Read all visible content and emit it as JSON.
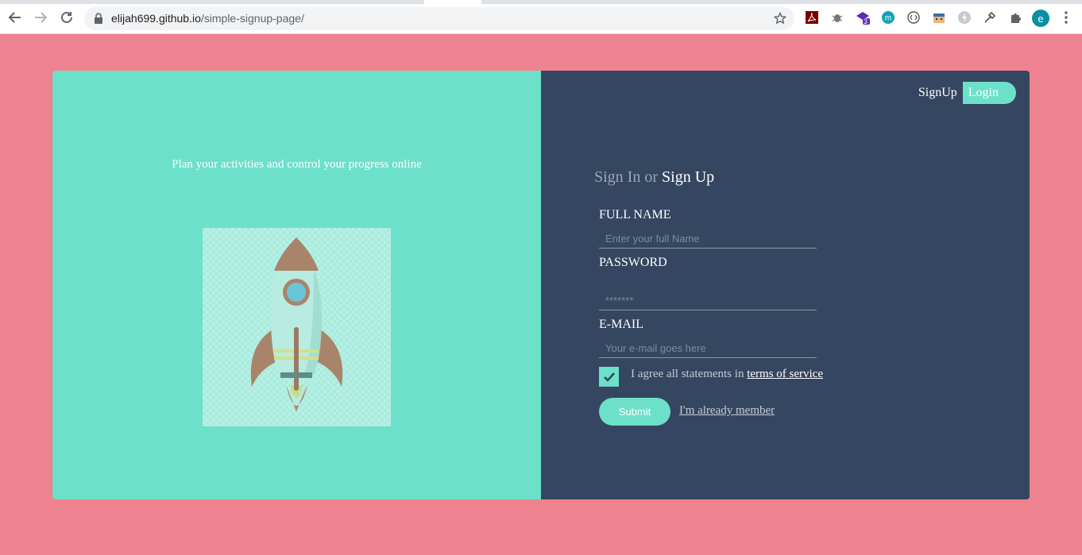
{
  "browser": {
    "url_host": "elijah699.github.io",
    "url_path": "/simple-signup-page/",
    "extension_badge": "3",
    "profile_initial": "e"
  },
  "colors": {
    "page_bg": "#ee838f",
    "accent": "#6ce0c9",
    "panel_dark": "#354660"
  },
  "left_panel": {
    "tagline": "Plan your activities and control your progress online",
    "illustration": "rocket-icon"
  },
  "top_nav": {
    "signup": "SignUp",
    "login": "Login"
  },
  "form": {
    "heading_prefix": "Sign In",
    "heading_or": " or ",
    "heading_signup": "Sign Up",
    "fullname_label": "FULL NAME",
    "fullname_placeholder": "Enter your full Name",
    "password_label": "PASSWORD",
    "password_placeholder": "*******",
    "email_label": "E-MAIL",
    "email_placeholder": "Your e-mail goes here",
    "agree_text": "I agree all statements in ",
    "terms_link": "terms of service",
    "submit": "Submit",
    "member_link": "I'm already member"
  }
}
